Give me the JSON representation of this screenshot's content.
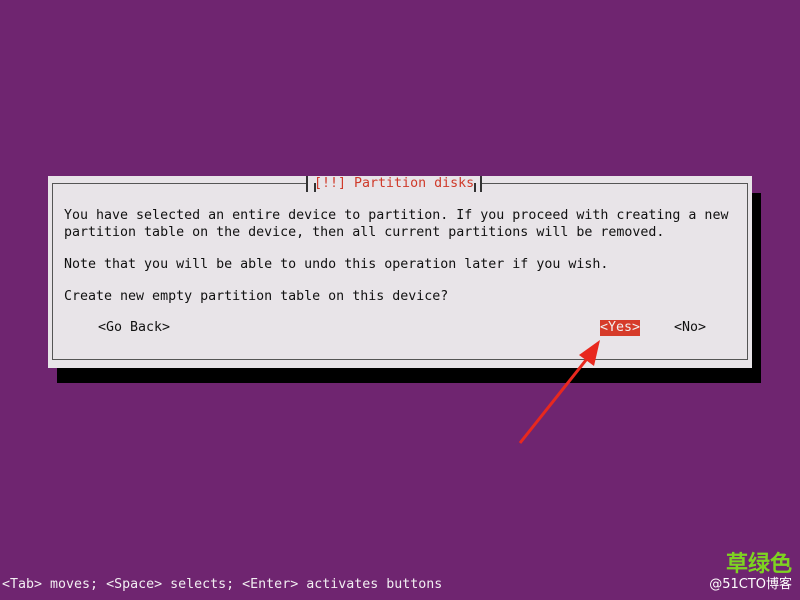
{
  "dialog": {
    "title": "[!!] Partition disks",
    "lines": [
      "You have selected an entire device to partition. If you proceed with creating a new",
      "partition table on the device, then all current partitions will be removed.",
      "Note that you will be able to undo this operation later if you wish.",
      "Create new empty partition table on this device?"
    ],
    "buttons": {
      "go_back": "<Go Back>",
      "yes": "<Yes>",
      "no": "<No>"
    },
    "selected_button": "yes"
  },
  "footer": {
    "help": "<Tab> moves; <Space> selects; <Enter> activates buttons"
  },
  "watermark": {
    "brand": "草绿色",
    "site": "@51CTO博客"
  },
  "colors": {
    "background": "#6f2570",
    "dialog_bg": "#e8e4e8",
    "selected_bg": "#d63b2a",
    "title_color": "#cf3a2a",
    "arrow_color": "#e8281e"
  }
}
